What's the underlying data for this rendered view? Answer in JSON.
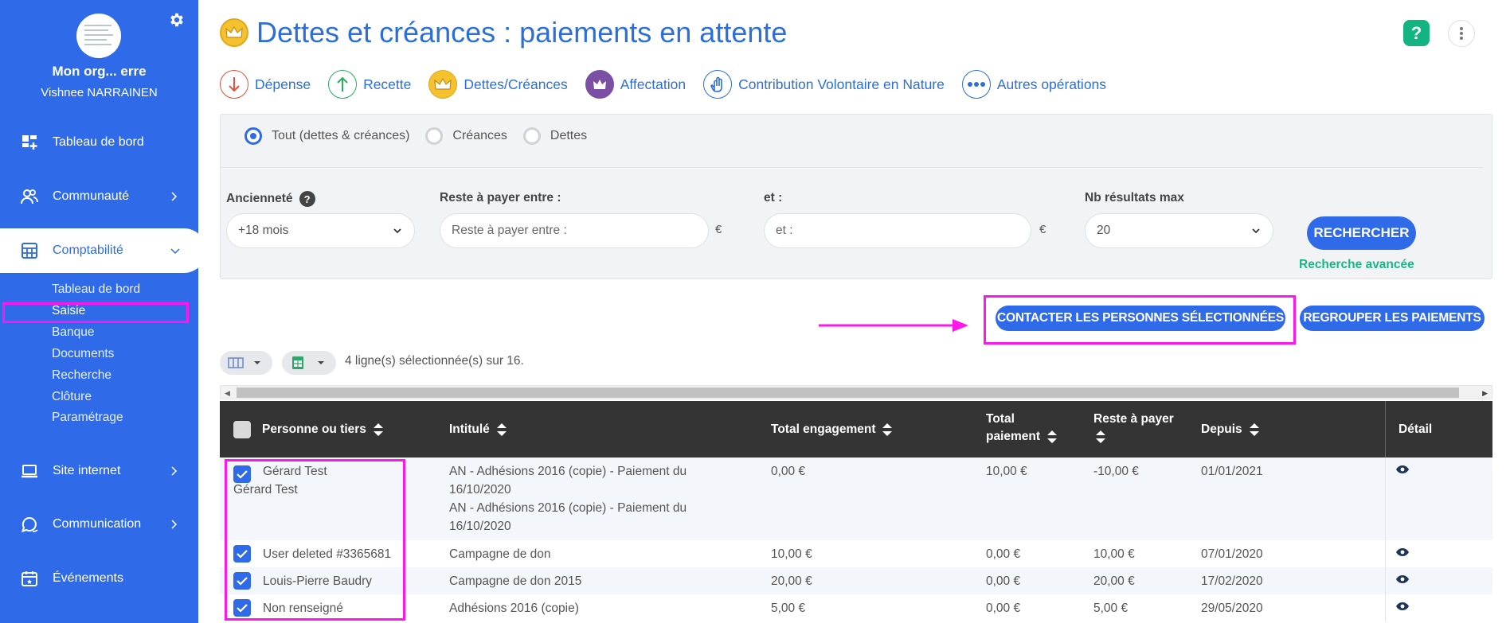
{
  "sidebar": {
    "org_name": "Mon org... erre",
    "user_name": "Vishnee NARRAINEN",
    "nav": [
      {
        "label": "Tableau de bord",
        "icon": "dashboard-icon"
      },
      {
        "label": "Communauté",
        "icon": "community-icon"
      },
      {
        "label": "Comptabilité",
        "icon": "calculator-icon"
      },
      {
        "label": "Site internet",
        "icon": "laptop-icon"
      },
      {
        "label": "Communication",
        "icon": "chat-icon"
      },
      {
        "label": "Événements",
        "icon": "calendar-icon"
      }
    ],
    "subitems": [
      "Tableau de bord",
      "Saisie",
      "Banque",
      "Documents",
      "Recherche",
      "Clôture",
      "Paramétrage"
    ]
  },
  "header": {
    "title": "Dettes et créances : paiements en attente",
    "help": "?"
  },
  "operations": [
    {
      "label": "Dépense",
      "icon": "arrow-down-icon",
      "color": "#e0523a"
    },
    {
      "label": "Recette",
      "icon": "arrow-up-icon",
      "color": "#27ae60"
    },
    {
      "label": "Dettes/Créances",
      "icon": "crown-icon",
      "color": "#f5c22f"
    },
    {
      "label": "Affectation",
      "icon": "assign-crown-icon",
      "color": "#7b4fa3"
    },
    {
      "label": "Contribution Volontaire en Nature",
      "icon": "hand-icon",
      "color": "#2c6fd6"
    },
    {
      "label": "Autres opérations",
      "icon": "dots-icon",
      "color": "#2c6fd6"
    }
  ],
  "filters": {
    "radios": [
      "Tout (dettes & créances)",
      "Créances",
      "Dettes"
    ],
    "anciennete_label": "Ancienneté",
    "anciennete_value": "+18 mois",
    "reste_label": "Reste à payer entre :",
    "reste_placeholder": "Reste à payer entre :",
    "et_label": "et :",
    "et_placeholder": "et :",
    "currency": "€",
    "nb_label": "Nb résultats max",
    "nb_value": "20",
    "search_button": "RECHERCHER",
    "advanced_link": "Recherche avancée"
  },
  "actions": {
    "contact": "CONTACTER LES PERSONNES SÉLECTIONNÉES",
    "group": "REGROUPER LES PAIEMENTS"
  },
  "table": {
    "selection_text": "4 ligne(s) sélectionnée(s) sur 16.",
    "headers": {
      "person": "Personne ou tiers",
      "intitule": "Intitulé",
      "total_engagement": "Total engagement",
      "total_paiement_1": "Total",
      "total_paiement_2": "paiement",
      "reste": "Reste à payer",
      "depuis": "Depuis",
      "detail": "Détail"
    },
    "rows": [
      {
        "person": "Gérard Test",
        "person2": "Gérard Test",
        "intitule": [
          "AN - Adhésions 2016 (copie) - Paiement du",
          "16/10/2020",
          "AN - Adhésions 2016 (copie) - Paiement du",
          "16/10/2020"
        ],
        "engagement": "0,00 €",
        "paiement": "10,00 €",
        "reste": "-10,00 €",
        "depuis": "01/01/2021"
      },
      {
        "person": "User deleted #3365681",
        "intitule": [
          "Campagne de don"
        ],
        "engagement": "10,00 €",
        "paiement": "0,00 €",
        "reste": "10,00 €",
        "depuis": "07/01/2020"
      },
      {
        "person": "Louis-Pierre Baudry",
        "intitule": [
          "Campagne de don 2015"
        ],
        "engagement": "20,00 €",
        "paiement": "0,00 €",
        "reste": "20,00 €",
        "depuis": "17/02/2020"
      },
      {
        "person": "Non renseigné",
        "intitule": [
          "Adhésions 2016 (copie)"
        ],
        "engagement": "5,00 €",
        "paiement": "0,00 €",
        "reste": "5,00 €",
        "depuis": "29/05/2020"
      }
    ]
  },
  "colors": {
    "primary": "#2f6be8",
    "title": "#2c6fd6",
    "annotation": "#ff16ea",
    "success": "#1fb38a"
  }
}
